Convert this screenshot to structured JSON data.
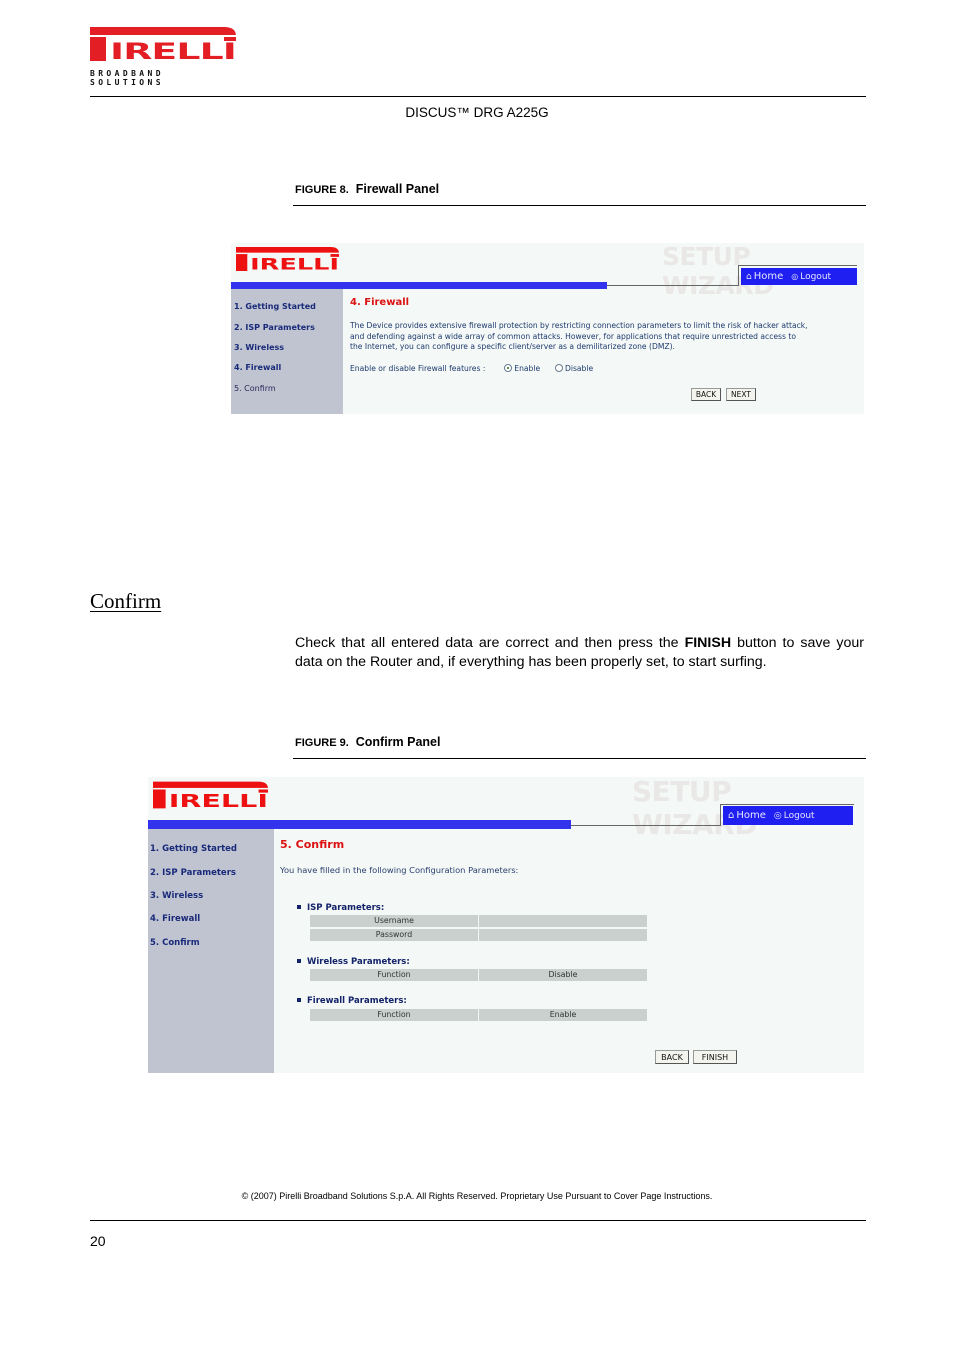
{
  "header": {
    "brand_name": "PIRELLI",
    "brand_sub_line1": "BROADBAND",
    "brand_sub_line2": "SOLUTIONS",
    "doc_title": "DISCUS™ DRG A225G"
  },
  "figure8": {
    "number": "FIGURE 8.",
    "title": "Firewall Panel",
    "panel": {
      "logo": "PIRELLI",
      "setup_title": "SETUP WIZARD",
      "nav": {
        "home": "Home",
        "logout": "Logout"
      },
      "sidebar": [
        {
          "label": "1. Getting Started",
          "active": true
        },
        {
          "label": "2. ISP Parameters",
          "active": true
        },
        {
          "label": "3. Wireless",
          "active": true
        },
        {
          "label": "4. Firewall",
          "active": true
        },
        {
          "label": "5. Confirm",
          "active": false
        }
      ],
      "heading": "4. Firewall",
      "description_lines": [
        "The Device provides extensive firewall protection by restricting connection parameters to limit the risk of hacker attack,",
        "and defending against a wide array of common attacks. However, for applications that require unrestricted access to",
        "the Internet, you can configure a specific client/server as a demilitarized zone (DMZ)."
      ],
      "firewall_label": "Enable or disable Firewall features :",
      "options": [
        {
          "label": "Enable",
          "selected": true
        },
        {
          "label": "Disable",
          "selected": false
        }
      ],
      "back_label": "BACK",
      "next_label": "NEXT"
    }
  },
  "section": {
    "title": "Confirm",
    "para_before": "Check that all entered data are correct and then press the ",
    "para_bold": "FINISH",
    "para_after": " button to save your data on the Router and, if everything has been properly set, to start surfing."
  },
  "figure9": {
    "number": "FIGURE 9.",
    "title": "Confirm Panel",
    "panel": {
      "logo": "PIRELLI",
      "setup_title": "SETUP WIZARD",
      "nav": {
        "home": "Home",
        "logout": "Logout"
      },
      "sidebar": [
        {
          "label": "1. Getting Started"
        },
        {
          "label": "2. ISP Parameters"
        },
        {
          "label": "3. Wireless"
        },
        {
          "label": "4. Firewall"
        },
        {
          "label": "5. Confirm"
        }
      ],
      "heading": "5. Confirm",
      "intro": "You have filled in the following Configuration Parameters:",
      "groups": [
        {
          "title": "ISP Parameters:",
          "rows": [
            {
              "name": "Username",
              "value": ""
            },
            {
              "name": "Password",
              "value": ""
            }
          ]
        },
        {
          "title": "Wireless Parameters:",
          "rows": [
            {
              "name": "Function",
              "value": "Disable"
            }
          ]
        },
        {
          "title": "Firewall Parameters:",
          "rows": [
            {
              "name": "Function",
              "value": "Enable"
            }
          ]
        }
      ],
      "back_label": "BACK",
      "finish_label": "FINISH"
    }
  },
  "footer": {
    "copyright": "© (2007) Pirelli Broadband Solutions S.p.A. All Rights Reserved. Proprietary Use Pursuant to Cover Page Instructions.",
    "page_number": "20"
  },
  "colors": {
    "brand_red": "#e31e24",
    "wizard_blue": "#3333ee",
    "nav_blue": "#1f1ff2",
    "sidebar_grey": "#bfc4d0",
    "heading_red": "#dd1111"
  }
}
